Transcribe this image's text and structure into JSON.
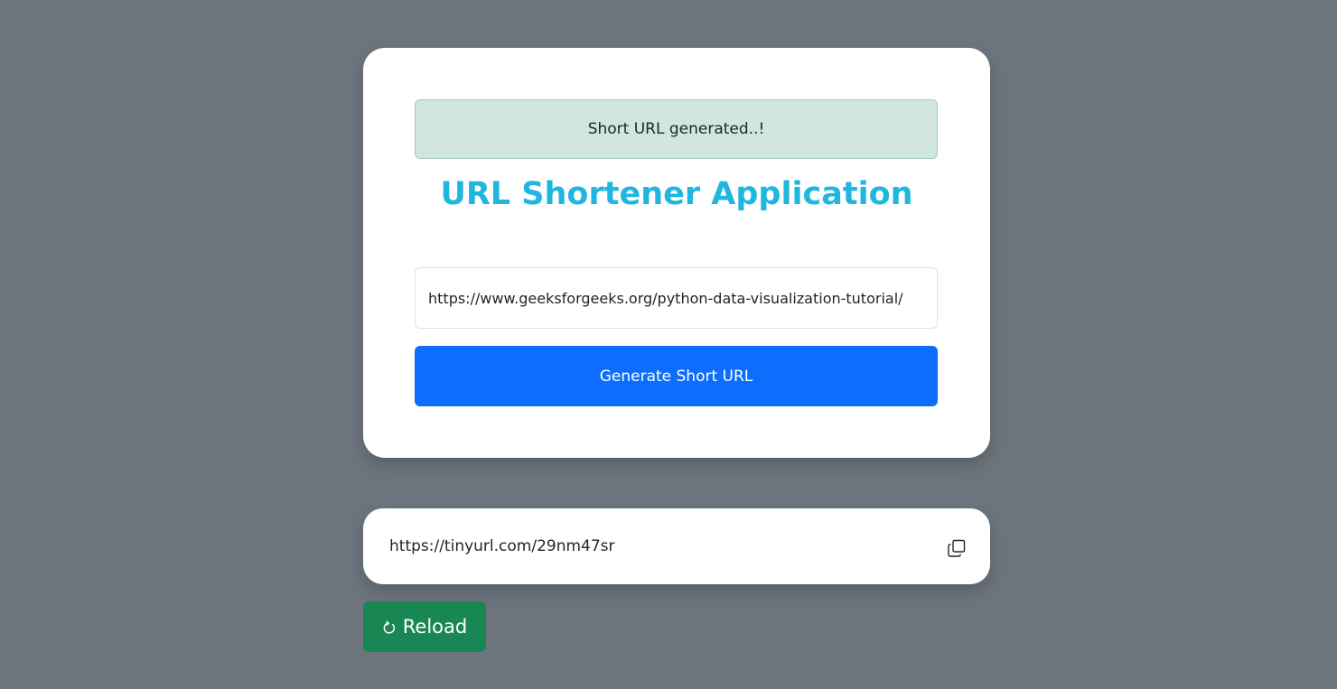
{
  "alert": {
    "text": "Short URL generated..!"
  },
  "app": {
    "title": "URL Shortener Application"
  },
  "form": {
    "url_value": "https://www.geeksforgeeks.org/python-data-visualization-tutorial/",
    "generate_label": "Generate Short URL"
  },
  "result": {
    "short_url": "https://tinyurl.com/29nm47sr",
    "copy_icon": "copy-icon"
  },
  "reload": {
    "label": "Reload",
    "icon": "reload-icon"
  },
  "colors": {
    "background": "#6c757d",
    "accent_title": "#1fb6e0",
    "primary": "#0d6efd",
    "success": "#198754",
    "alert_bg": "#d1e7dd"
  }
}
